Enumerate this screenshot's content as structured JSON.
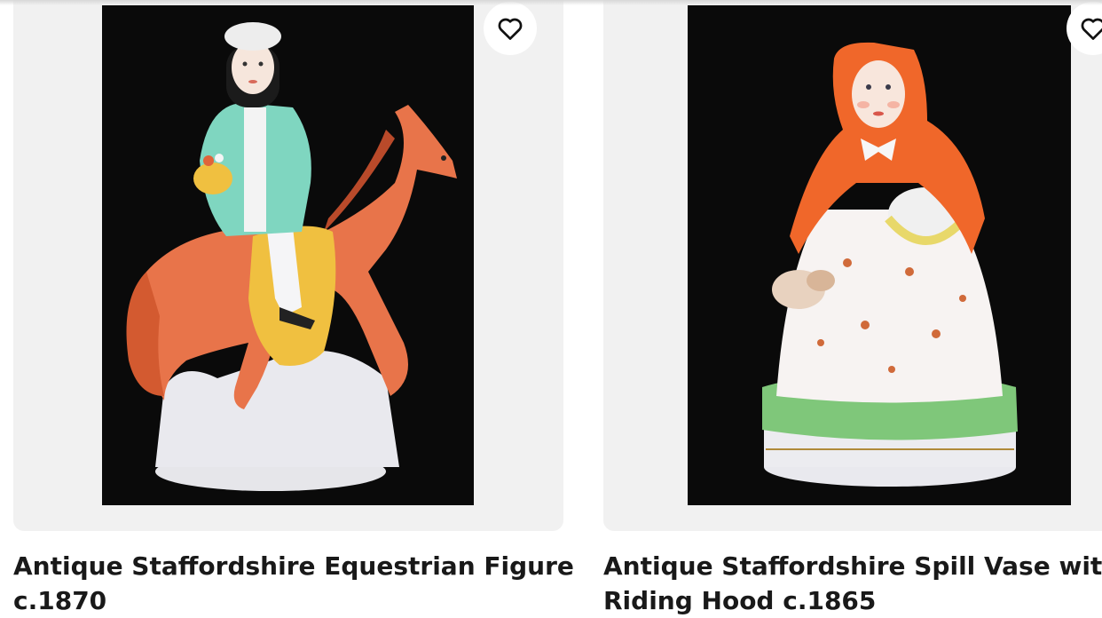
{
  "listings": [
    {
      "title_line1": "Antique Staffordshire Equestrian Figure",
      "title_line2": "c.1870",
      "image_alt": "Staffordshire figure of rider on orange horse",
      "favorite_icon": "heart-outline-icon"
    },
    {
      "title_line1": "Antique Staffordshire Spill Vase with Re",
      "title_line2": "Riding Hood c.1865",
      "image_alt": "Staffordshire figure of girl in orange hooded cape",
      "favorite_icon": "heart-outline-icon"
    }
  ],
  "colors": {
    "panel_bg": "#f1f1f1",
    "photo_bg": "#0a0a0a",
    "title_text": "#191919"
  }
}
